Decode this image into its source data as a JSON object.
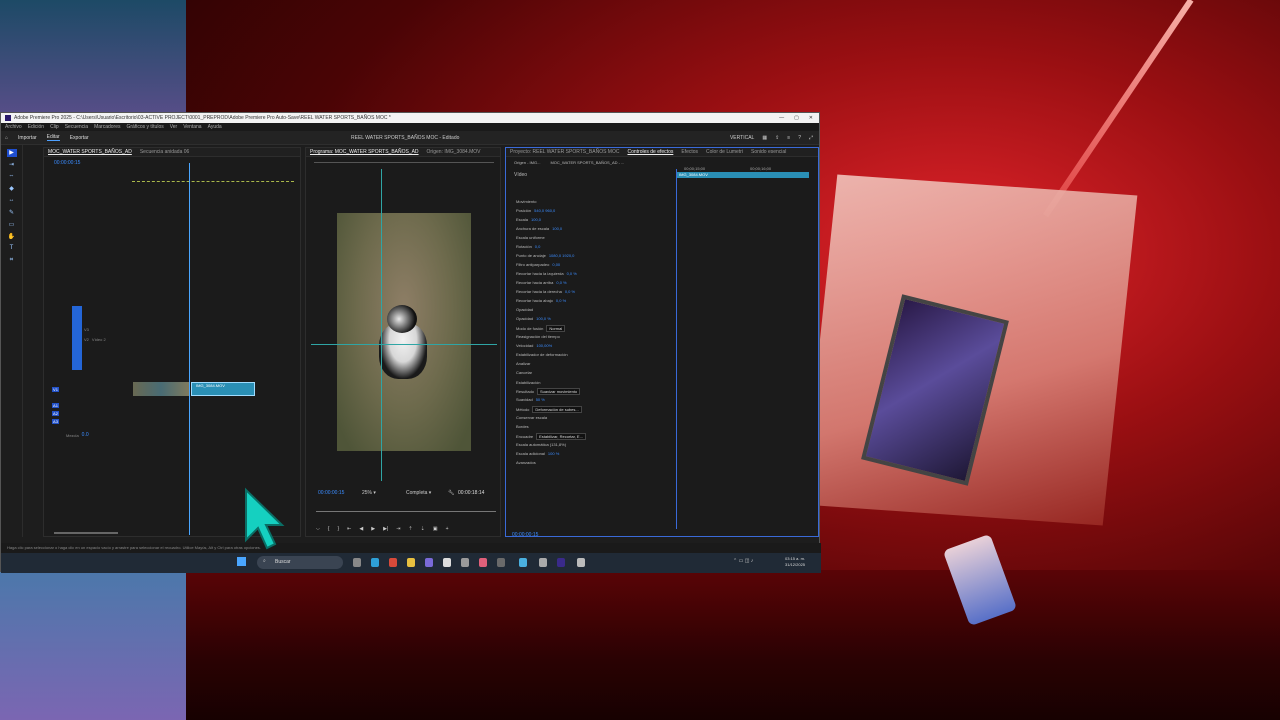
{
  "app": {
    "title": "Adobe Premiere Pro 2025 - C:\\Users\\Usuario\\Escritorio\\03-ACTIVE PROJECT\\0001_PREPROD\\Adobe Premiere Pro Auto-Save\\REEL WATER SPORTS_BAÑOS MOC *",
    "project_name": "REEL WATER SPORTS_BAÑOS MOC",
    "project_state": "Editado",
    "workspace_label": "VERTICAL"
  },
  "menu": [
    "Archivo",
    "Edición",
    "Clip",
    "Secuencia",
    "Marcadores",
    "Gráficos y títulos",
    "Ver",
    "Ventana",
    "Ayuda"
  ],
  "workspaces": [
    "Importar",
    "Editar",
    "Exportar"
  ],
  "timeline": {
    "tabs": [
      "MOC_WATER SPORTS_BAÑOS_AD",
      "Secuencia anidada 06"
    ],
    "timecode": "00:00:00:15",
    "tracks": [
      {
        "id": "V3",
        "name": ""
      },
      {
        "id": "V2",
        "name": "Vídeo 2"
      },
      {
        "id": "V1",
        "name": ""
      },
      {
        "id": "A1",
        "name": ""
      },
      {
        "id": "A2",
        "name": ""
      },
      {
        "id": "A3",
        "name": ""
      }
    ],
    "mix_label": "Mezcla",
    "mix_value": "0.0",
    "clip_name": "IMG_3084.MOV"
  },
  "program": {
    "tabs": [
      "Programa: MOC_WATER SPORTS_BAÑOS_AD",
      "Origen: IMG_3084.MOV"
    ],
    "timecode_in": "00:00:00:15",
    "zoom": "25%",
    "quality": "Completa",
    "timecode_out": "00:00:18:14"
  },
  "effects": {
    "tabs": [
      "Proyecto: REEL WATER SPORTS_BAÑOS MOC",
      "Controles de efectos",
      "Efectos",
      "Color de Lumetri",
      "Sonido esencial"
    ],
    "subtabs": [
      "Origen - IMG...",
      "MOC_WATER SPORTS_BAÑOS_AD - ..."
    ],
    "section_video": "Vídeo",
    "rows": [
      {
        "label": "Movimiento",
        "value": ""
      },
      {
        "label": "Posición",
        "value": "540,0    960,0"
      },
      {
        "label": "Escala",
        "value": "100,0"
      },
      {
        "label": "Anchura de escala",
        "value": "100,0"
      },
      {
        "label": "Escala uniforme",
        "value": ""
      },
      {
        "label": "Rotación",
        "value": "0,0"
      },
      {
        "label": "Punto de anclaje",
        "value": "1080,0    1920,0"
      },
      {
        "label": "Filtro antiparpadeo",
        "value": "0,00"
      },
      {
        "label": "Recortar hacia la izquierda",
        "value": "0,0 %"
      },
      {
        "label": "Recortar hacia arriba",
        "value": "0,0 %"
      },
      {
        "label": "Recortar hacia la derecha",
        "value": "0,0 %"
      },
      {
        "label": "Recortar hacia abajo",
        "value": "0,0 %"
      },
      {
        "label": "Opacidad",
        "value": ""
      },
      {
        "label": "Opacidad",
        "value": "100,0 %"
      },
      {
        "label": "Modo de fusión",
        "value": "Normal"
      },
      {
        "label": "Reasignación del tiempo",
        "value": ""
      },
      {
        "label": "Velocidad",
        "value": "100,00%"
      },
      {
        "label": "Estabilizador de deformación",
        "value": ""
      },
      {
        "label": "Analizar",
        "value": ""
      },
      {
        "label": "Cancelar",
        "value": ""
      },
      {
        "label": "Estabilización",
        "value": ""
      },
      {
        "label": "Resultado",
        "value": "Suavizar movimiento"
      },
      {
        "label": "Suavidad",
        "value": "50 %"
      },
      {
        "label": "Método",
        "value": "Deformación de subes..."
      },
      {
        "label": "Conservar escala",
        "value": ""
      },
      {
        "label": "Bordes",
        "value": ""
      },
      {
        "label": "Encuadre",
        "value": "Estabilizar, Recortar, E..."
      },
      {
        "label": "Escala automática (131,8%)",
        "value": ""
      },
      {
        "label": "Escala adicional",
        "value": "100 %"
      },
      {
        "label": "Avanzados",
        "value": ""
      }
    ],
    "mini_timeline_times": [
      "00;00;15;00",
      "00;00;16;00"
    ],
    "mini_clip": "IMG_3084.MOV",
    "bottom_timecode": "00:00:00:15"
  },
  "status_text": "Haga clic para seleccionar o haga clic en un espacio vacío y arrastre para seleccionar el recuadro. Utilice Mayús, Alt y Ctrl para otras opciones.",
  "taskbar": {
    "search_placeholder": "Buscar",
    "time": "03:15 a. m.",
    "date": "31/12/2025"
  }
}
